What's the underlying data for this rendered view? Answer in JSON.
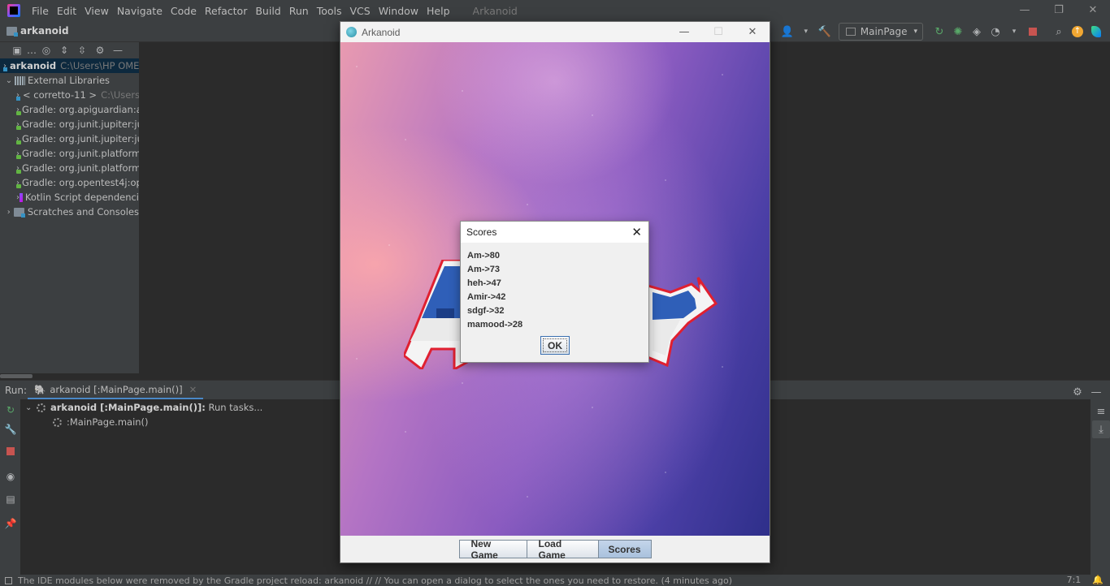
{
  "menubar": {
    "items": [
      "File",
      "Edit",
      "View",
      "Navigate",
      "Code",
      "Refactor",
      "Build",
      "Run",
      "Tools",
      "VCS",
      "Window",
      "Help"
    ],
    "project_title": "Arkanoid"
  },
  "navbar": {
    "project": "arkanoid",
    "run_config": "MainPage"
  },
  "project_tree": [
    {
      "label": "arkanoid",
      "suffix": "C:\\Users\\HP OMEN",
      "icon": "module-folder-icon",
      "level": 0
    },
    {
      "label": "External Libraries",
      "suffix": "",
      "icon": "libraries-icon",
      "level": 0
    },
    {
      "label": "< corretto-11 >",
      "suffix": "C:\\Users",
      "icon": "jdk-icon",
      "level": 1
    },
    {
      "label": "Gradle: org.apiguardian:a",
      "suffix": "",
      "icon": "gradle-library-icon",
      "level": 1
    },
    {
      "label": "Gradle: org.junit.jupiter:ju",
      "suffix": "",
      "icon": "gradle-library-icon",
      "level": 1
    },
    {
      "label": "Gradle: org.junit.jupiter:ju",
      "suffix": "",
      "icon": "gradle-library-icon",
      "level": 1
    },
    {
      "label": "Gradle: org.junit.platform",
      "suffix": "",
      "icon": "gradle-library-icon",
      "level": 1
    },
    {
      "label": "Gradle: org.junit.platform",
      "suffix": "",
      "icon": "gradle-library-icon",
      "level": 1
    },
    {
      "label": "Gradle: org.opentest4j:op",
      "suffix": "",
      "icon": "gradle-library-icon",
      "level": 1
    },
    {
      "label": "Kotlin Script dependenci",
      "suffix": "",
      "icon": "kotlin-script-icon",
      "level": 1
    },
    {
      "label": "Scratches and Consoles",
      "suffix": "",
      "icon": "scratches-icon",
      "level": 0
    }
  ],
  "run_panel": {
    "label": "Run:",
    "tab": "arkanoid [:MainPage.main()]",
    "root_bold": "arkanoid [:MainPage.main()]:",
    "root_rest": " Run tasks...",
    "child": ":MainPage.main()"
  },
  "statusbar": {
    "message": "The IDE modules below were removed by the Gradle project reload: arkanoid // // You can open a dialog to select the ones you need to restore. (4 minutes ago)",
    "position": "7:1"
  },
  "game_window": {
    "title": "Arkanoid",
    "buttons": {
      "new_game": "New Game",
      "load_game": "Load Game",
      "scores": "Scores"
    }
  },
  "scores_dialog": {
    "title": "Scores",
    "entries": [
      "Am->80",
      "Am->73",
      "heh->47",
      "Amir->42",
      "sdgf->32",
      "mamood->28"
    ],
    "ok_label": "OK"
  },
  "colors": {
    "ide_background": "#2b2b2b",
    "ide_panel": "#3c3f41",
    "selection": "#0d293e",
    "accent_blue": "#4a88c7"
  }
}
